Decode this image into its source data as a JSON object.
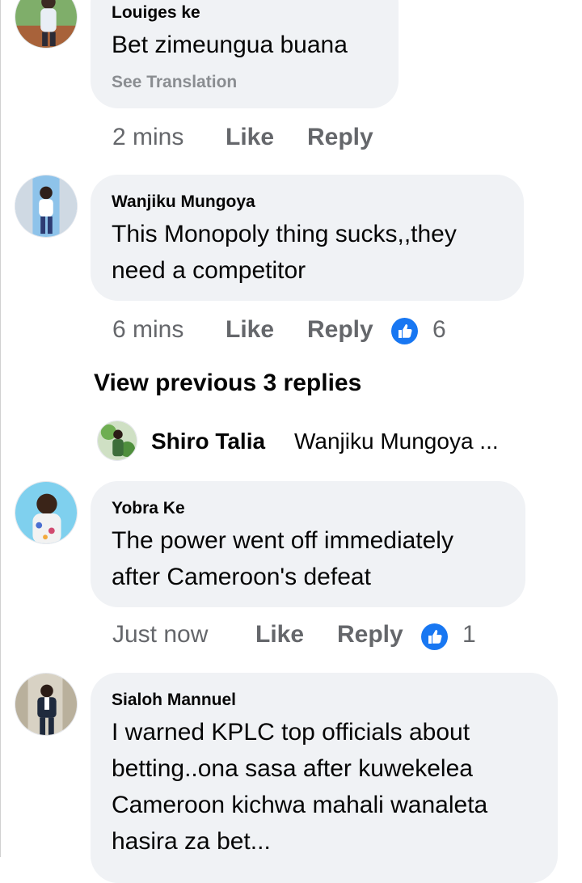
{
  "comments": [
    {
      "author": "Louiges ke",
      "text_lines": [
        "Bet zimeungua buana"
      ],
      "see_translation": "See Translation",
      "time": "2 mins",
      "like": "Like",
      "reply": "Reply",
      "avatar_icon": "person-avatar-icon"
    },
    {
      "author": "Wanjiku Mungoya",
      "text_lines": [
        "This Monopoly thing sucks,,they",
        "need a competitor"
      ],
      "time": "6 mins",
      "like": "Like",
      "reply": "Reply",
      "reaction_count": "6",
      "reaction_icon": "like-reaction-icon",
      "avatar_icon": "person-avatar-icon"
    },
    {
      "author": "Yobra Ke",
      "text_lines": [
        "The power went off immediately",
        "after Cameroon's defeat"
      ],
      "time": "Just now",
      "like": "Like",
      "reply": "Reply",
      "reaction_count": "1",
      "reaction_icon": "like-reaction-icon",
      "avatar_icon": "person-avatar-icon"
    },
    {
      "author": "Sialoh Mannuel",
      "text_lines": [
        "I warned KPLC top officials about",
        "betting..ona sasa after kuwekelea",
        "Cameroon kichwa mahali wanaleta",
        "hasira za bet..."
      ],
      "avatar_icon": "person-avatar-icon"
    }
  ],
  "view_previous": "View previous 3 replies",
  "reply_preview": {
    "author": "Shiro Talia",
    "text": "Wanjiku Mungoya ..."
  },
  "colors": {
    "bubble": "#f0f2f5",
    "meta_text": "#65676b",
    "translate_text": "#8a8d91",
    "like_blue": "#1877f2"
  }
}
